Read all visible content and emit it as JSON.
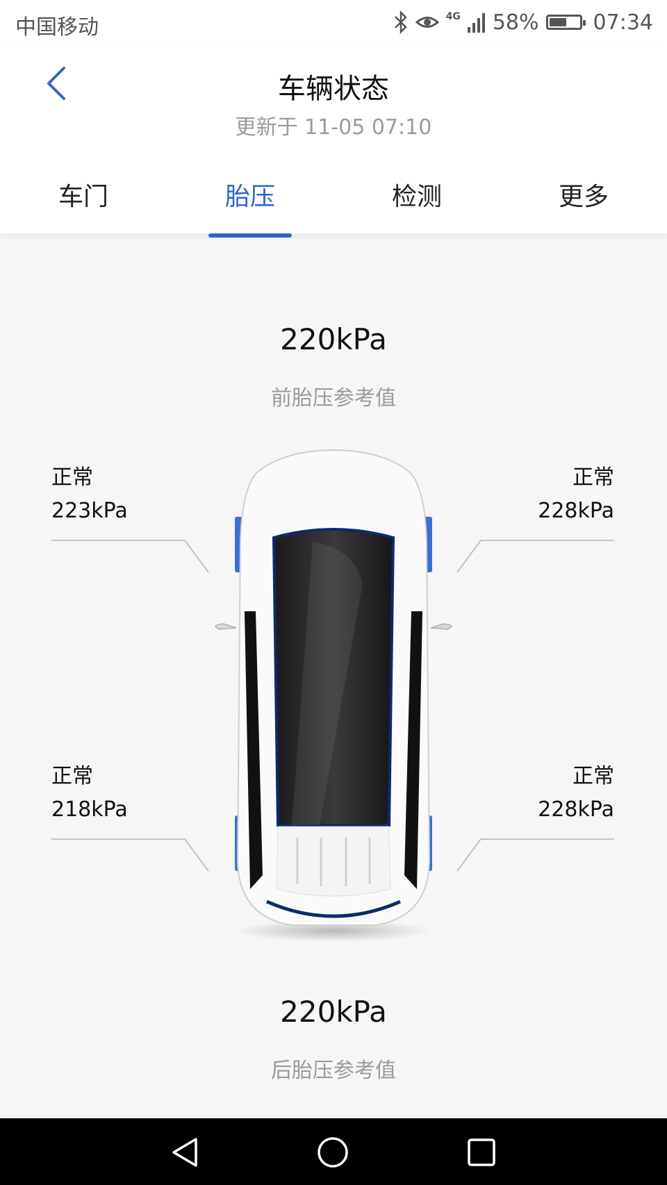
{
  "status_bar": {
    "carrier": "中国移动",
    "network": "4G",
    "battery": "58%",
    "battery_level": 0.58,
    "time": "07:34"
  },
  "header": {
    "title": "车辆状态",
    "updated": "更新于 11-05 07:10",
    "tabs": [
      "车门",
      "胎压",
      "检测",
      "更多"
    ],
    "active_tab": "胎压"
  },
  "pressure": {
    "front_ref_value": "220kPa",
    "front_ref_label": "前胎压参考值",
    "rear_ref_value": "220kPa",
    "rear_ref_label": "后胎压参考值",
    "front_left": {
      "status": "正常",
      "value": "223kPa"
    },
    "front_right": {
      "status": "正常",
      "value": "228kPa"
    },
    "rear_left": {
      "status": "正常",
      "value": "218kPa"
    },
    "rear_right": {
      "status": "正常",
      "value": "228kPa"
    }
  },
  "colors": {
    "accent": "#2f68c8",
    "tire_highlight": "#3a6fd0"
  },
  "icons": [
    "back-chevron-icon",
    "bluetooth-icon",
    "eye-icon",
    "signal-icon",
    "battery-icon",
    "nav-back-icon",
    "nav-home-icon",
    "nav-recent-icon"
  ]
}
